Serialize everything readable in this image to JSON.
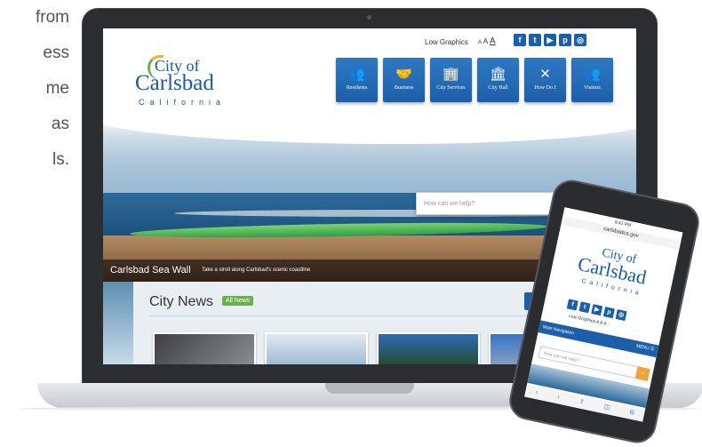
{
  "side_text": [
    "from",
    "ess",
    "me",
    "as",
    "ls."
  ],
  "site": {
    "low_graphics": "Low Graphics",
    "text_size": {
      "small": "A",
      "medium": "A",
      "large": "A"
    },
    "social": [
      {
        "icon": "facebook-icon",
        "glyph": "f"
      },
      {
        "icon": "twitter-icon",
        "glyph": "t"
      },
      {
        "icon": "youtube-icon",
        "glyph": "▶"
      },
      {
        "icon": "pinterest-icon",
        "glyph": "p"
      },
      {
        "icon": "instagram-icon",
        "glyph": "◎"
      }
    ],
    "logo": {
      "line1": "City of",
      "line2": "Carlsbad",
      "line3": "California"
    },
    "nav": [
      {
        "label": "Residents",
        "icon": "people-icon",
        "glyph": "👥"
      },
      {
        "label": "Business",
        "icon": "handshake-icon",
        "glyph": "🤝"
      },
      {
        "label": "City Services",
        "icon": "building-icon",
        "glyph": "🏢"
      },
      {
        "label": "City Hall",
        "icon": "columns-icon",
        "glyph": "🏛"
      },
      {
        "label": "How Do I",
        "icon": "tools-icon",
        "glyph": "✕"
      },
      {
        "label": "Visitors",
        "icon": "group-icon",
        "glyph": "👥"
      }
    ],
    "hero": {
      "caption_title": "Carlsbad Sea Wall",
      "caption_sub": "Take a stroll along Carlsbad's scenic coastline",
      "search_placeholder": "How can we help?"
    },
    "news": {
      "title": "City News",
      "all_news": "All News"
    }
  },
  "phone": {
    "status": "9:41 PM",
    "url": "carlsbadca.gov",
    "logo": {
      "line1": "City of",
      "line2": "Carlsbad",
      "line3": "California"
    },
    "low_graphics": "Low Graphics",
    "text_size": "A A A",
    "main_navigation": "Main Navigation",
    "menu": "MENU ☰",
    "search_placeholder": "How can we help?",
    "toolbar": [
      "‹",
      "›",
      "⇪",
      "◫",
      "⧉"
    ]
  },
  "colors": {
    "brand_blue": "#1c5fa8",
    "brand_green": "#6ab04c",
    "accent_orange": "#f0a33a"
  }
}
